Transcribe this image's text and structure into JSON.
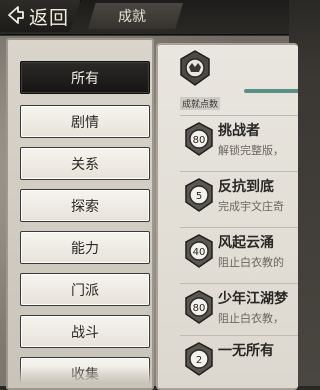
{
  "header": {
    "back_label": "返回",
    "title": "成就"
  },
  "tabs": [
    {
      "label": "所有",
      "active": true
    },
    {
      "label": "剧情",
      "active": false
    },
    {
      "label": "关系",
      "active": false
    },
    {
      "label": "探索",
      "active": false
    },
    {
      "label": "能力",
      "active": false
    },
    {
      "label": "门派",
      "active": false
    },
    {
      "label": "战斗",
      "active": false
    },
    {
      "label": "收集",
      "active": false
    }
  ],
  "points": {
    "label": "成就点数"
  },
  "achievements": [
    {
      "badge": "80",
      "name": "挑战者",
      "desc": "解锁完整版，"
    },
    {
      "badge": "5",
      "name": "反抗到底",
      "desc": "完成宇文庄奇"
    },
    {
      "badge": "40",
      "name": "风起云涌",
      "desc": "阻止白衣教的"
    },
    {
      "badge": "80",
      "name": "少年江湖梦",
      "desc": "阻止白衣教，"
    },
    {
      "badge": "2",
      "name": "一无所有",
      "desc": ""
    }
  ],
  "colors": {
    "accent_bar": "#5b8f86",
    "badge_ring": "#3a3733"
  }
}
